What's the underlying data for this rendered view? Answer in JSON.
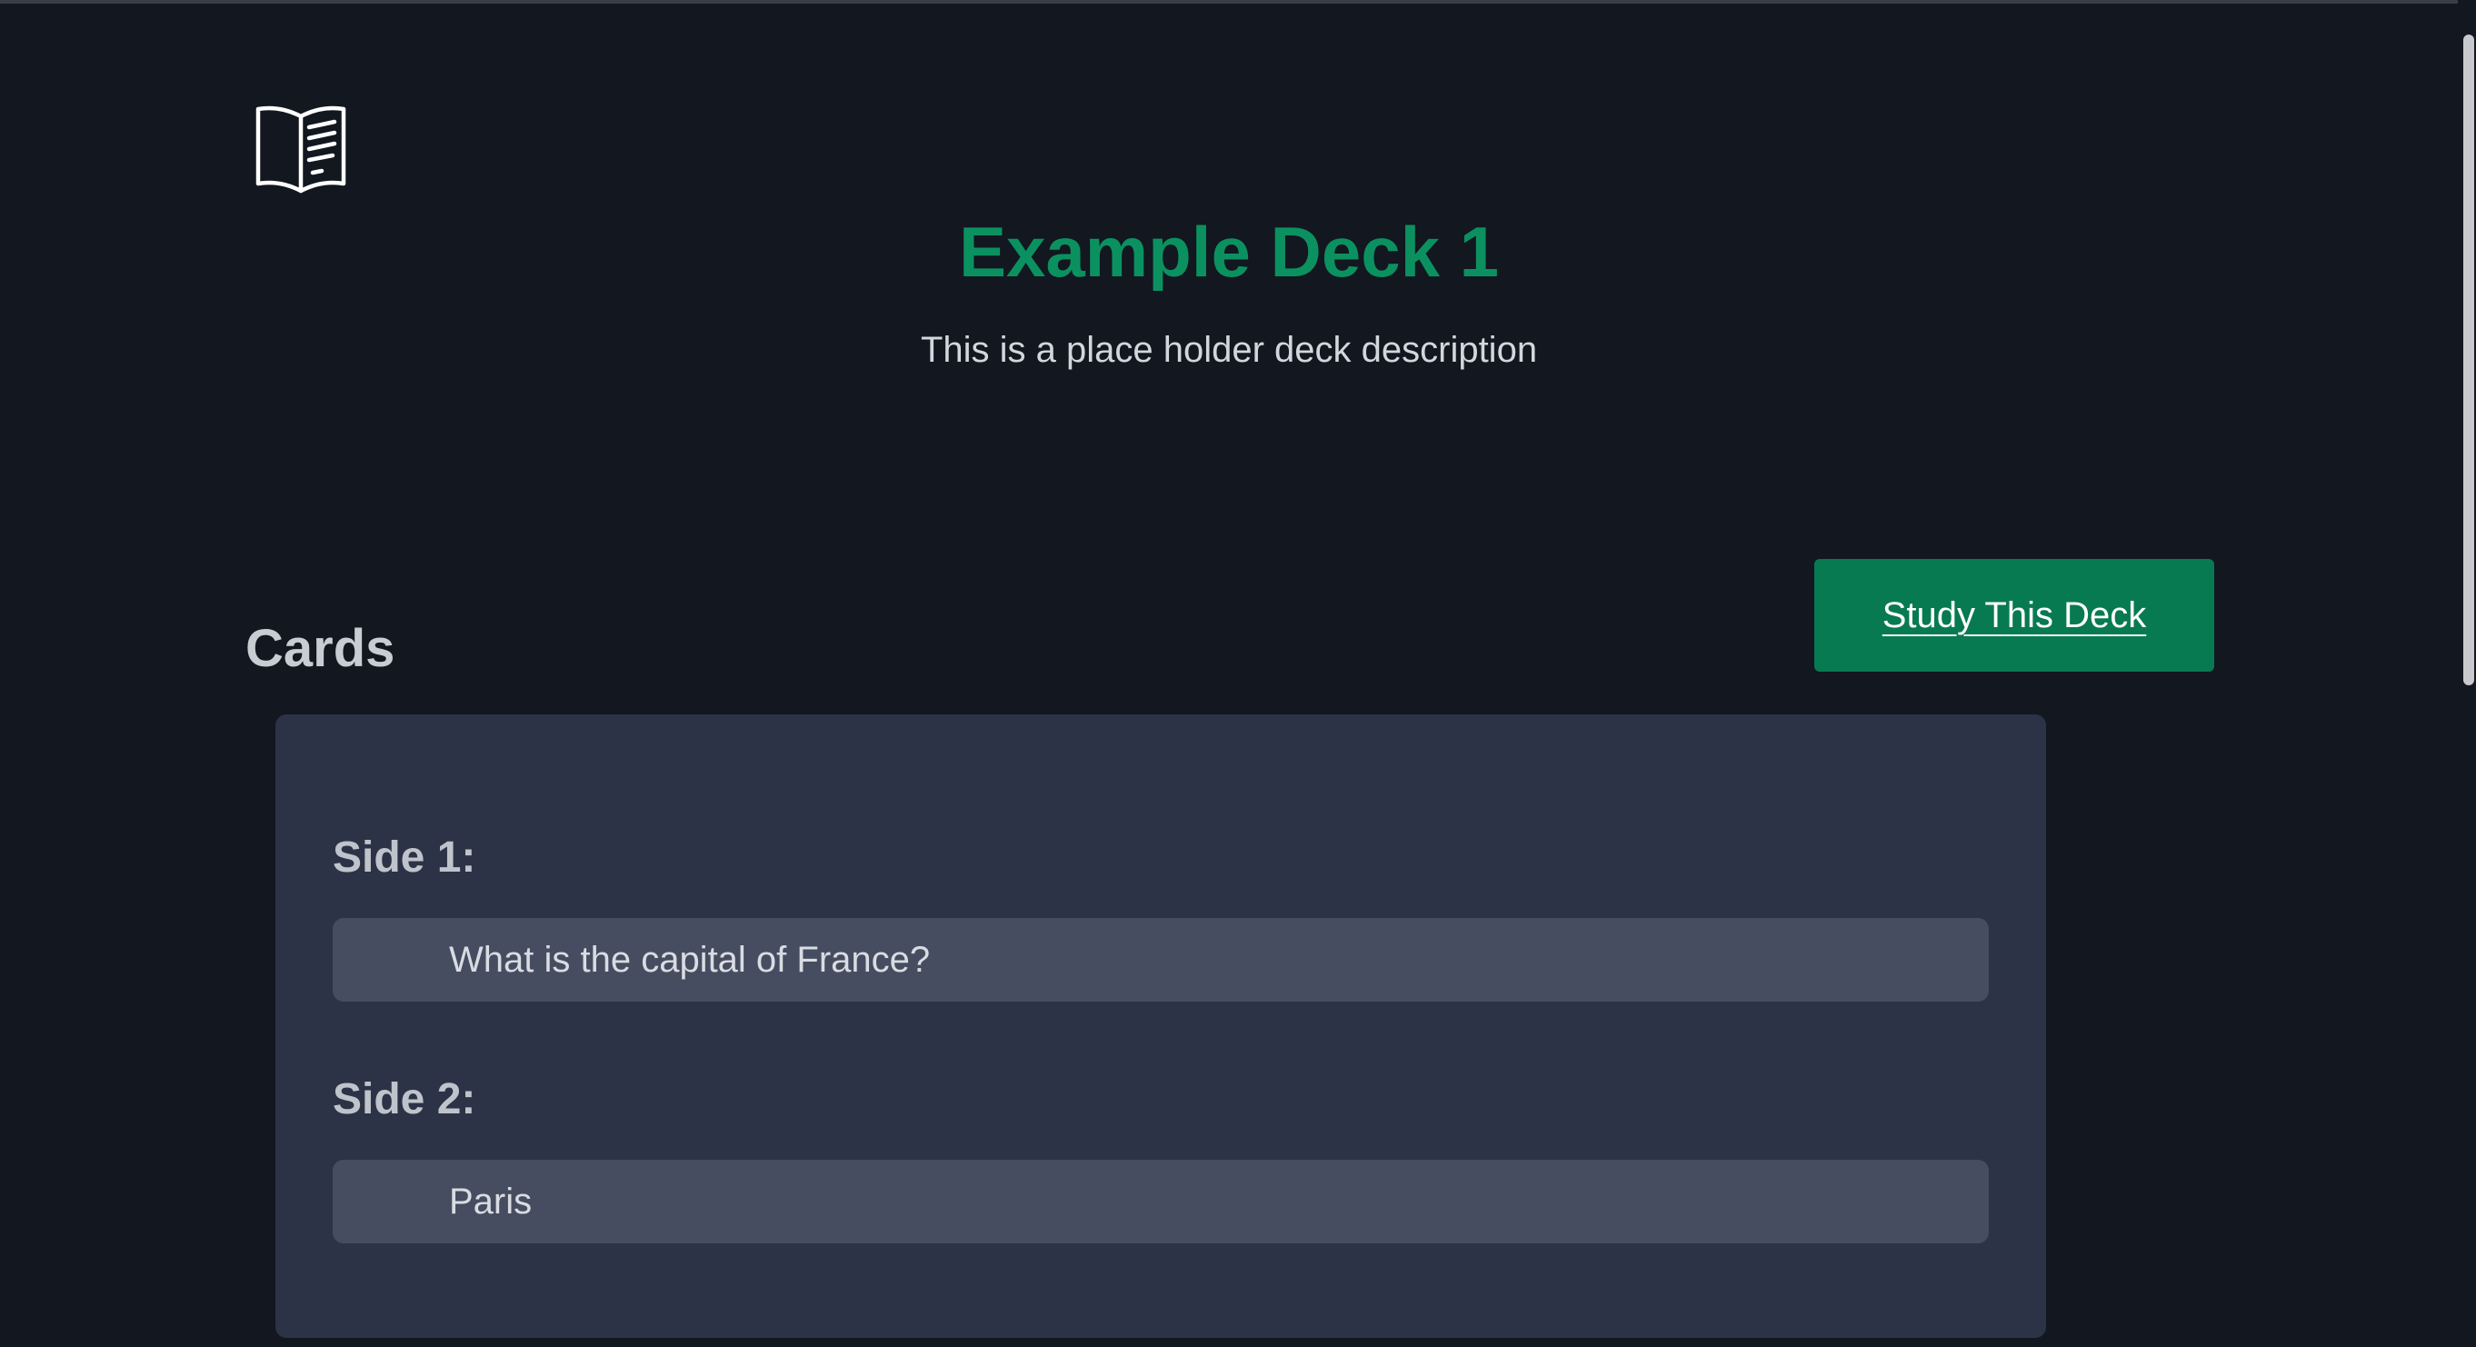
{
  "deck": {
    "title": "Example Deck 1",
    "description": "This is a place holder deck description"
  },
  "cards_section": {
    "heading": "Cards",
    "study_button_label": "Study This Deck"
  },
  "cards": [
    {
      "side1_label": "Side 1:",
      "side1_value": "What is the capital of France?",
      "side2_label": "Side 2:",
      "side2_value": "Paris"
    }
  ],
  "logo_icon": "open-book-icon",
  "colors": {
    "background": "#121720",
    "accent": "#0b9160",
    "button": "#077a52",
    "card": "#2c3346",
    "field": "#464d60"
  }
}
